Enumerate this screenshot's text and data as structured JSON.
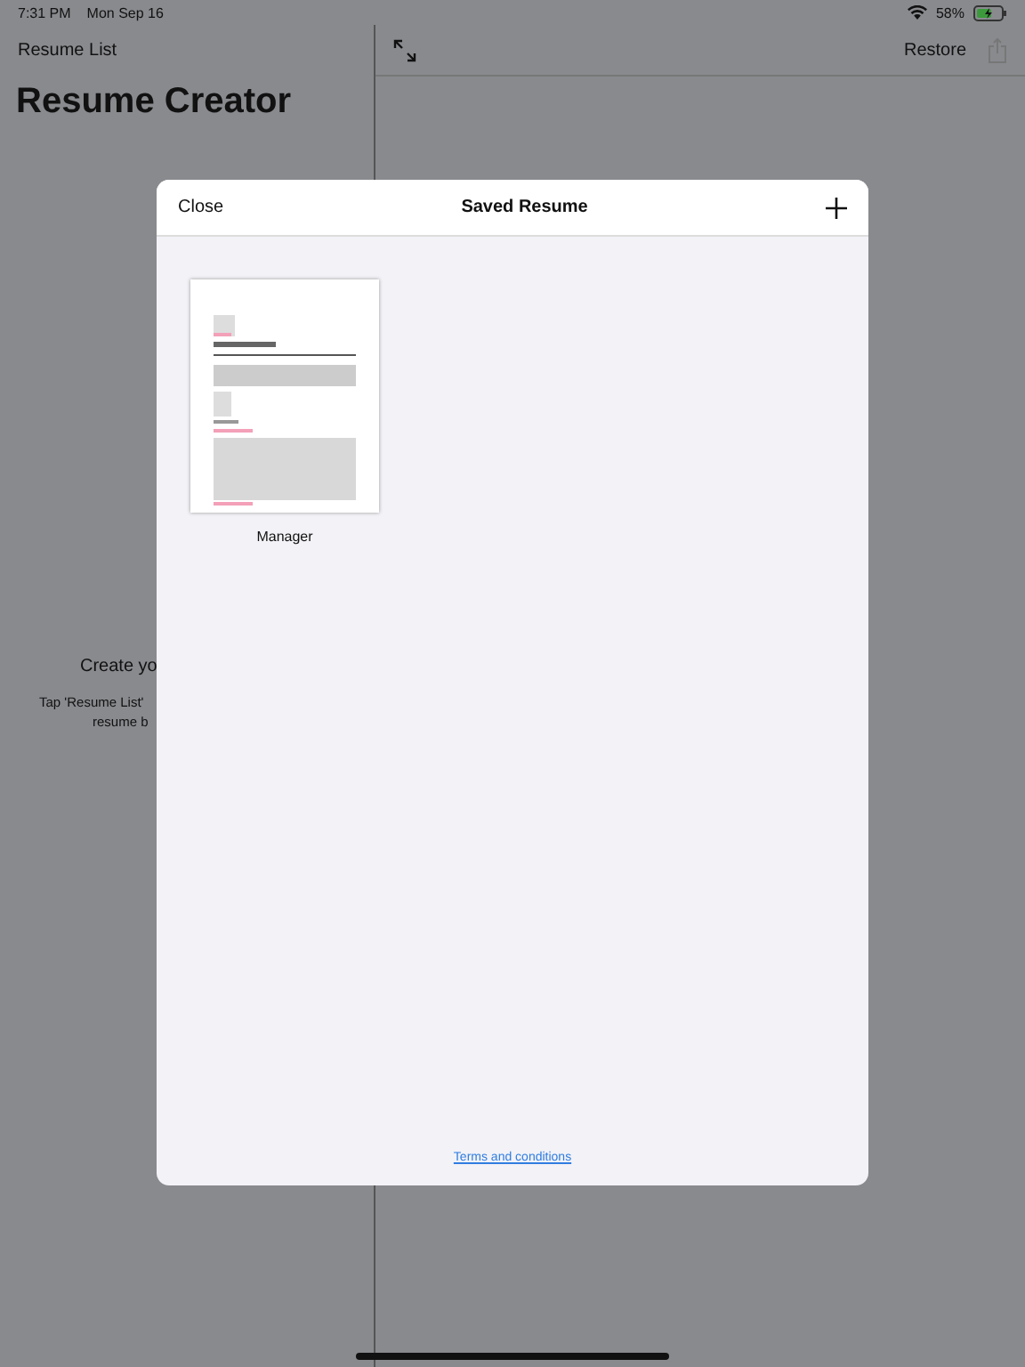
{
  "status_bar": {
    "time": "7:31 PM",
    "date": "Mon Sep 16",
    "battery": "58%"
  },
  "sidebar": {
    "back_label": "Resume List",
    "title": "Resume Creator",
    "empty_title": "Create yo",
    "empty_hint": [
      "Tap 'Resume List'",
      "resume b"
    ]
  },
  "detail": {
    "restore": "Restore"
  },
  "modal": {
    "close": "Close",
    "title": "Saved Resume",
    "resumes": [
      {
        "name": "Manager",
        "kind": "picture"
      }
    ],
    "footer_link": "Terms and conditions"
  }
}
